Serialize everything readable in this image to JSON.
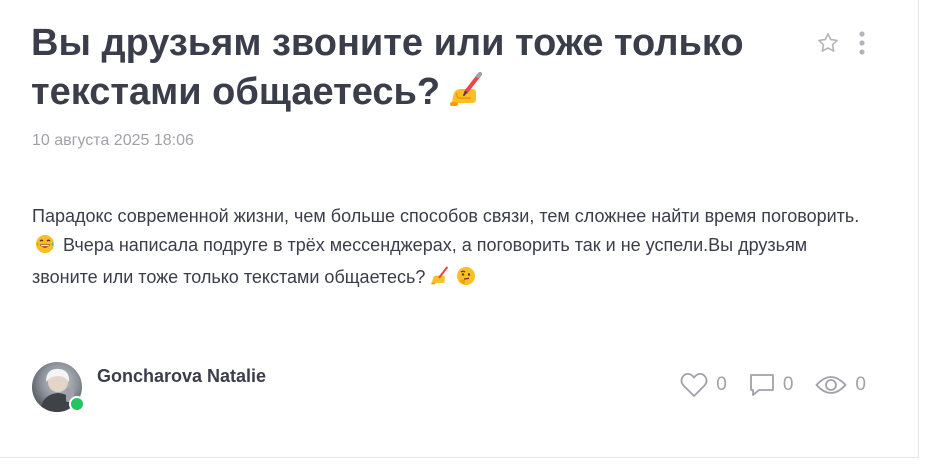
{
  "post": {
    "title": "Вы друзьям звоните или тоже только текстами общаетесь?",
    "date": "10 августа 2025 18:06",
    "body_part1": "Парадокс современной жизни, чем больше способов связи, тем сложнее найти время поговорить.",
    "body_part2": "Вчера написала подруге в трёх мессенджерах, а поговорить так и не успели.Вы друзьям звоните или тоже только текстами общаетесь?"
  },
  "author": {
    "name": "Goncharova Natalie",
    "online": true
  },
  "stats": {
    "likes": "0",
    "comments": "0",
    "views": "0"
  },
  "icons": {
    "favorite": "star-icon",
    "menu": "more-vertical-icon",
    "title_emoji": "writing-hand-emoji",
    "laugh_emoji": "laughing-tears-emoji",
    "think_emoji": "thinking-face-emoji",
    "like": "heart-icon",
    "comment": "comment-icon",
    "view": "eye-icon"
  },
  "colors": {
    "text": "#3a3d4a",
    "muted": "#a1a1aa",
    "online": "#22c55e"
  }
}
